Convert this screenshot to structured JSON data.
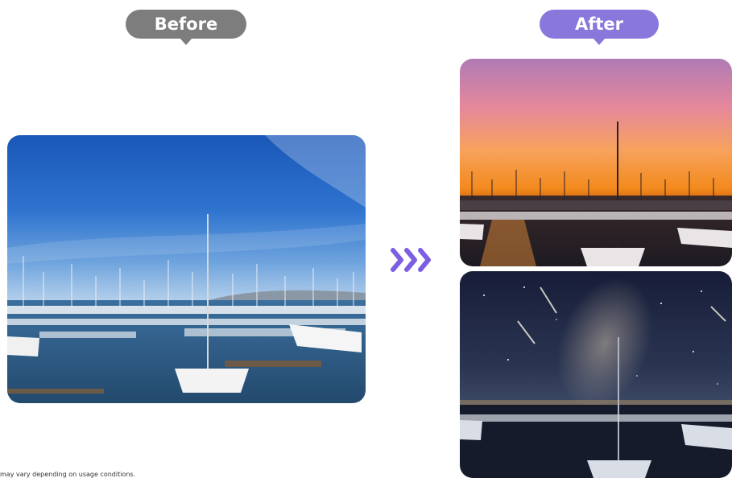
{
  "labels": {
    "before": "Before",
    "after": "After"
  },
  "images": {
    "before": "marina-daytime-blue-sky",
    "after_top": "marina-sunset",
    "after_bottom": "marina-night-milky-way"
  },
  "icons": {
    "transition": "triple-chevron-right-icon"
  },
  "colors": {
    "before_label_bg": "#7d7d7d",
    "after_label_bg": "#8a77dc",
    "arrow": "#7b5fe0"
  },
  "disclaimer": "may vary depending on usage conditions."
}
